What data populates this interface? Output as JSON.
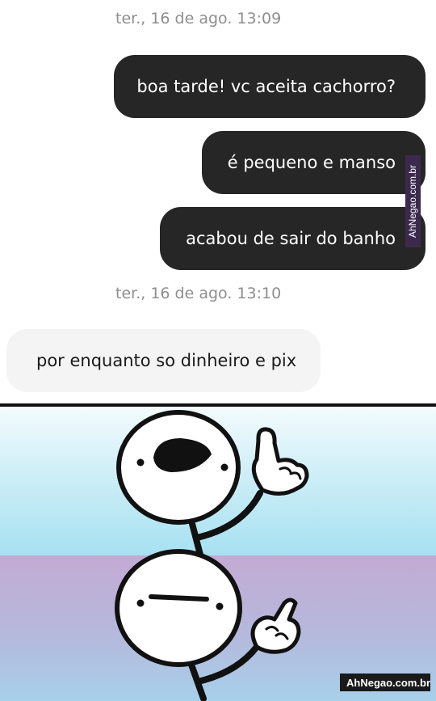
{
  "chat": {
    "timestamp_1": "ter., 16 de ago. 13:09",
    "timestamp_2": "ter., 16 de ago. 13:10",
    "outgoing": [
      "boa tarde! vc aceita cachorro?",
      "é pequeno e manso",
      "acabou de sair do banho"
    ],
    "incoming": [
      "por enquanto so dinheiro e pix"
    ]
  },
  "watermark": {
    "side": "AhNegao.com.br",
    "bottom": "AhNegao.com.br"
  },
  "meme": {
    "panels": [
      {
        "name": "excited-stickman",
        "icon": "stickman-talking-finger-up-icon"
      },
      {
        "name": "disappointed-stickman",
        "icon": "stickman-blank-finger-down-icon"
      }
    ],
    "colors": {
      "panel_top": "#a6e1f1",
      "panel_bottom": "#c3aad3",
      "bubble_out": "#262626",
      "bubble_in": "#f4f4f4"
    }
  }
}
